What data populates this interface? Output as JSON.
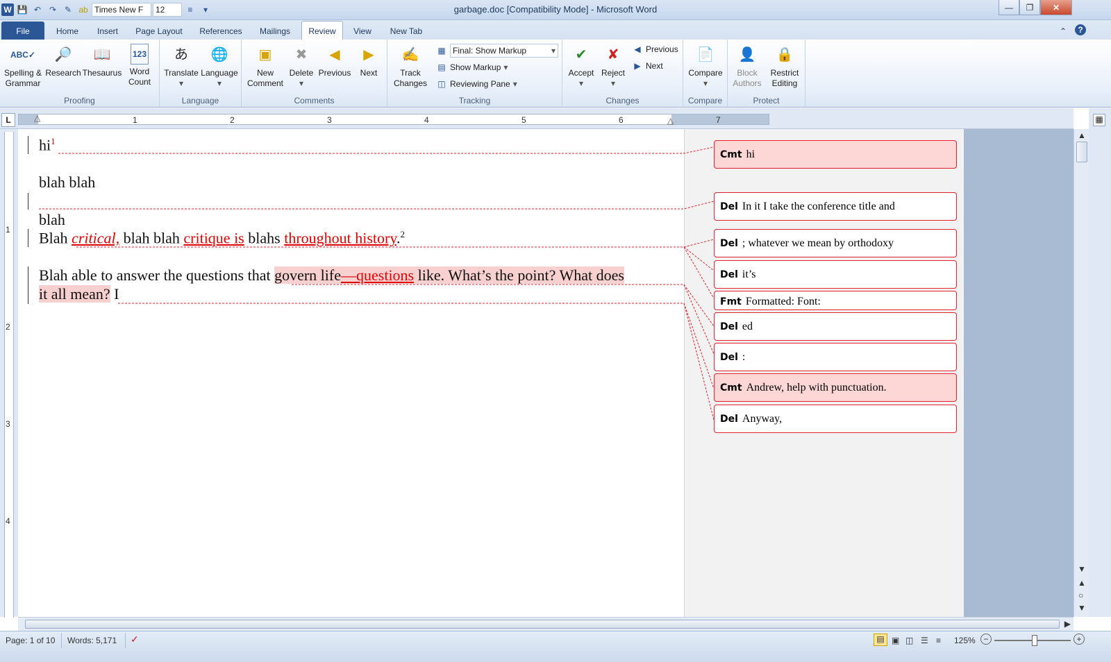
{
  "app": {
    "window_title": "garbage.doc [Compatibility Mode]  -  Microsoft Word",
    "font_name": "Times New F",
    "font_size": "12"
  },
  "tabs": [
    "File",
    "Home",
    "Insert",
    "Page Layout",
    "References",
    "Mailings",
    "Review",
    "View",
    "New Tab"
  ],
  "active_tab": "Review",
  "ribbon": {
    "proofing": {
      "label": "Proofing",
      "spelling": "Spelling &",
      "spelling2": "Grammar",
      "research": "Research",
      "thesaurus": "Thesaurus",
      "wordcount": "Word",
      "wordcount2": "Count"
    },
    "language": {
      "label": "Language",
      "translate": "Translate",
      "language": "Language"
    },
    "comments": {
      "label": "Comments",
      "new": "New",
      "new2": "Comment",
      "delete": "Delete",
      "previous": "Previous",
      "next": "Next"
    },
    "tracking": {
      "label": "Tracking",
      "track": "Track",
      "track2": "Changes",
      "markup_select": "Final: Show Markup",
      "show_markup": "Show Markup",
      "reviewing_pane": "Reviewing Pane"
    },
    "changes": {
      "label": "Changes",
      "accept": "Accept",
      "reject": "Reject",
      "previous": "Previous",
      "next": "Next"
    },
    "compare": {
      "label": "Compare",
      "compare": "Compare"
    },
    "protect": {
      "label": "Protect",
      "block": "Block",
      "block2": "Authors",
      "restrict": "Restrict",
      "restrict2": "Editing"
    }
  },
  "ruler": {
    "h_numbers": [
      "1",
      "2",
      "3",
      "4",
      "5",
      "6",
      "7"
    ],
    "v_numbers": [
      "1",
      "2",
      "3",
      "4"
    ]
  },
  "document": {
    "line1": "hi",
    "line1_sup": "1",
    "line2": "blah blah",
    "line3": "blah",
    "p1": {
      "a": "Blah ",
      "b": "critical,",
      "c": " blah blah ",
      "d": "critique is",
      "e": " blahs ",
      "f": "throughout history",
      "g": ".",
      "sup": "2"
    },
    "p2": {
      "a": "Blah able to answer the questions that ",
      "b": "govern life",
      "c": "—questions",
      "d": " like",
      "e": ". What’s the point? What does",
      "f": "it all mean?",
      "g": " I"
    }
  },
  "balloons": [
    {
      "mark": "Cmt",
      "text": "hi"
    },
    {
      "mark": "Del",
      "text": "In it I take the conference title  and"
    },
    {
      "mark": "Del",
      "text": "; whatever we mean by orthodoxy"
    },
    {
      "mark": "Del",
      "text": "it’s"
    },
    {
      "mark": "Fmt",
      "text": "Formatted: Font:"
    },
    {
      "mark": "Del",
      "text": "ed"
    },
    {
      "mark": "Del",
      "text": ":"
    },
    {
      "mark": "Cmt",
      "text": "Andrew, help with punctuation."
    },
    {
      "mark": "Del",
      "text": "Anyway,"
    }
  ],
  "status": {
    "page": "Page: 1 of 10",
    "words": "Words: 5,171",
    "zoom": "125%"
  },
  "colors": {
    "accent": "#2b5797",
    "markup": "#e00000",
    "balloon_border": "#e2232f",
    "balloon_fill": "#fdd6d6"
  }
}
